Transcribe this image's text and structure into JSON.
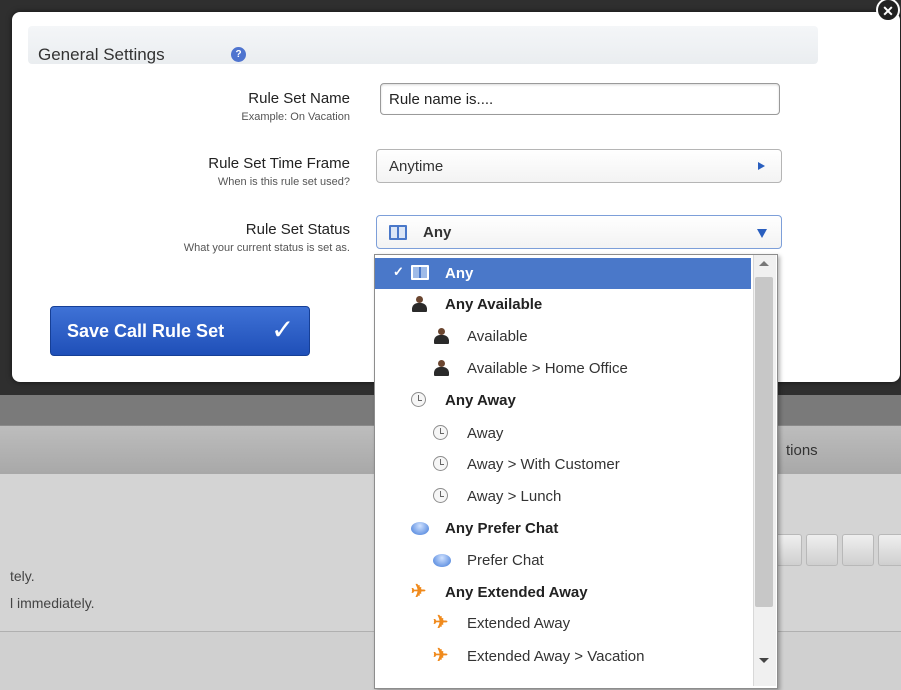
{
  "dialog": {
    "title": "General Settings",
    "help_glyph": "?",
    "close_glyph": "✕"
  },
  "fields": {
    "name": {
      "label": "Rule Set Name",
      "hint": "Example: On Vacation",
      "value": "Rule name is...."
    },
    "timeframe": {
      "label": "Rule Set Time Frame",
      "hint": "When is this rule set used?",
      "value": "Anytime"
    },
    "status": {
      "label": "Rule Set Status",
      "hint": "What your current status is set as.",
      "value": "Any"
    }
  },
  "save_button": {
    "label": "Save Call Rule Set",
    "check_glyph": "✓"
  },
  "status_dropdown": {
    "items": [
      {
        "label": "Any",
        "icon": "book-icon",
        "group": true,
        "selected": true
      },
      {
        "label": "Any Available",
        "icon": "person-icon",
        "group": true
      },
      {
        "label": "Available",
        "icon": "person-icon",
        "group": false
      },
      {
        "label": "Available > Home Office",
        "icon": "person-icon",
        "group": false
      },
      {
        "label": "Any Away",
        "icon": "clock-icon",
        "group": true
      },
      {
        "label": "Away",
        "icon": "clock-icon",
        "group": false
      },
      {
        "label": "Away > With Customer",
        "icon": "clock-icon",
        "group": false
      },
      {
        "label": "Away > Lunch",
        "icon": "clock-icon",
        "group": false
      },
      {
        "label": "Any Prefer Chat",
        "icon": "chat-icon",
        "group": true
      },
      {
        "label": "Prefer Chat",
        "icon": "chat-icon",
        "group": false
      },
      {
        "label": "Any Extended Away",
        "icon": "plane-icon",
        "group": true
      },
      {
        "label": "Extended Away",
        "icon": "plane-icon",
        "group": false
      },
      {
        "label": "Extended Away > Vacation",
        "icon": "plane-icon",
        "group": false
      }
    ],
    "check_glyph": "✓"
  },
  "background": {
    "header_fragment": "tions",
    "text_line_1": "tely.",
    "text_line_2": "l immediately."
  },
  "colors": {
    "accent": "#2a5fbf",
    "selected_bg": "#4a78c9",
    "button": "#2a5ccb"
  }
}
